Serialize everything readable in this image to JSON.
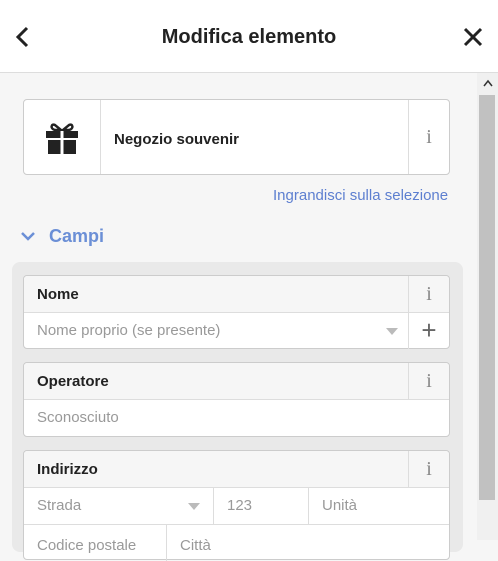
{
  "header": {
    "title": "Modifica elemento",
    "back_icon": "chevron-left-icon",
    "close_icon": "close-icon"
  },
  "preset": {
    "name": "Negozio souvenir",
    "icon": "gift-icon",
    "info_label": "i"
  },
  "zoom_link": "Ingrandisci sulla selezione",
  "fields_section": {
    "label": "Campi",
    "expanded": true
  },
  "fields": {
    "name": {
      "label": "Nome",
      "placeholder": "Nome proprio (se presente)",
      "info_label": "i",
      "add_label": "+"
    },
    "operator": {
      "label": "Operatore",
      "placeholder": "Sconosciuto",
      "info_label": "i"
    },
    "address": {
      "label": "Indirizzo",
      "info_label": "i",
      "street_placeholder": "Strada",
      "housenumber_placeholder": "123",
      "unit_placeholder": "Unità",
      "postcode_placeholder": "Codice postale",
      "city_placeholder": "Città"
    }
  },
  "colors": {
    "accent": "#6b8fd6",
    "link": "#5d7fd0"
  }
}
